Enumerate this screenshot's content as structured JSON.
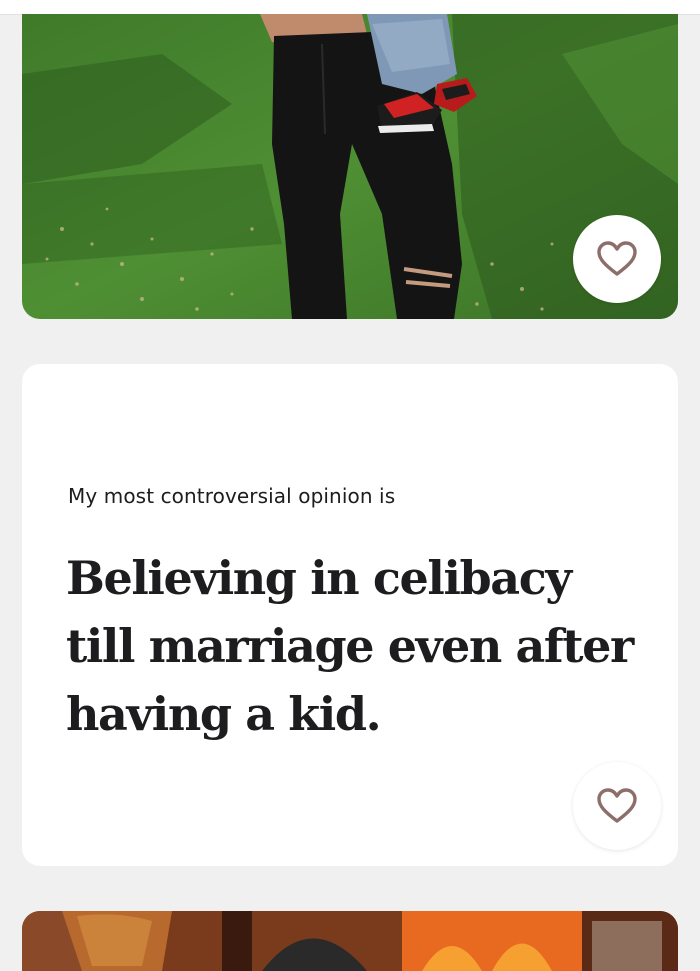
{
  "prompt_card": {
    "question": "My most controversial opinion is",
    "answer": "Believing in celibacy till marriage even after having a kid."
  },
  "icons": {
    "like": "heart-outline-icon"
  },
  "colors": {
    "page_background": "#f0f0f0",
    "card_background": "#ffffff",
    "text": "#1d1d1f",
    "heart_stroke": "#8c6f6b"
  }
}
